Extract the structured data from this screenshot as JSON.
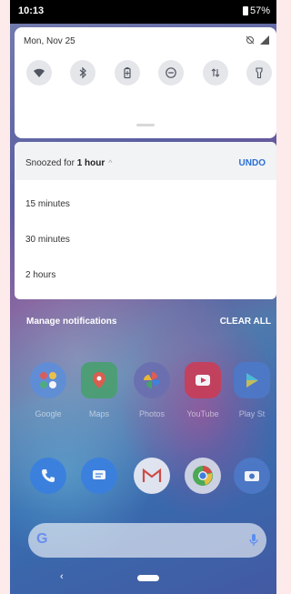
{
  "status_bar": {
    "time": "10:13",
    "battery": "57%"
  },
  "quick_settings": {
    "date": "Mon, Nov 25",
    "tiles": [
      "wifi-icon",
      "bluetooth-icon",
      "battery-saver-icon",
      "do-not-disturb-icon",
      "mobile-data-icon",
      "flashlight-icon"
    ]
  },
  "snooze": {
    "prefix": "Snoozed for ",
    "duration": "1 hour",
    "undo_label": "UNDO",
    "options": [
      "15 minutes",
      "30 minutes",
      "2 hours"
    ]
  },
  "notifications_footer": {
    "manage_label": "Manage notifications",
    "clear_all_label": "CLEAR ALL"
  },
  "home": {
    "apps_row1": [
      "Google",
      "Maps",
      "Photos",
      "YouTube",
      "Play St"
    ]
  },
  "colors": {
    "accent": "#2a6fd6",
    "status_bar_bg": "#000000"
  }
}
